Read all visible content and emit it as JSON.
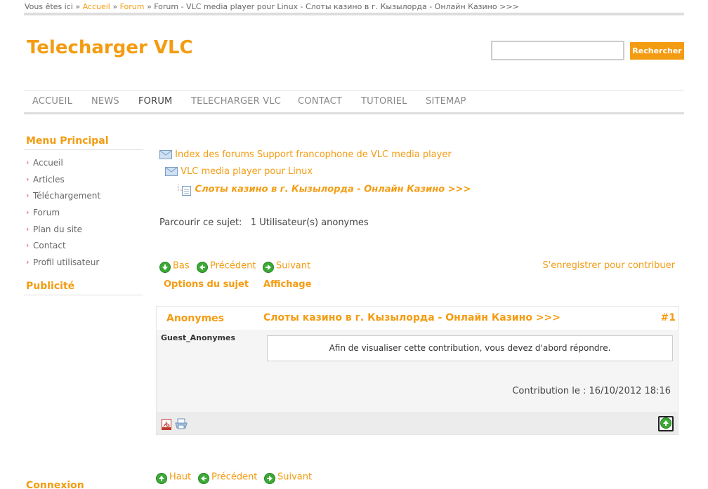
{
  "breadcrumb": {
    "prefix": "Vous êtes ici",
    "sep": "»",
    "items": [
      "Accueil",
      "Forum"
    ],
    "current": "Forum - VLC media player pour Linux - Слоты казино в г. Кызылорда - Онлайн Казино >>>"
  },
  "site": {
    "title": "Telecharger VLC"
  },
  "search": {
    "button": "Rechercher",
    "value": ""
  },
  "nav": [
    "ACCUEIL",
    "NEWS",
    "FORUM",
    "TELECHARGER VLC",
    "CONTACT",
    "TUTORIEL",
    "SITEMAP"
  ],
  "sidebar": {
    "menu_title": "Menu Principal",
    "items": [
      "Accueil",
      "Articles",
      "Téléchargement",
      "Forum",
      "Plan du site",
      "Contact",
      "Profil utilisateur"
    ],
    "pub_title": "Publicité",
    "login_title": "Connexion"
  },
  "forum": {
    "index_link": "Index des forums Support francophone de VLC media player",
    "sub_link": "VLC media player pour Linux",
    "topic": "Слоты казино в г. Кызылорда - Онлайн Казино >>>",
    "browse_label": "Parcourir ce sujet:",
    "browse_value": "1 Utilisateur(s) anonymes",
    "bas": "Bas",
    "precedent": "Précédent",
    "suivant": "Suivant",
    "register": "S'enregistrer pour contribuer",
    "options": "Options du sujet",
    "affichage": "Affichage",
    "haut": "Haut"
  },
  "post": {
    "author": "Anonymes",
    "title": "Слоты казино в г. Кызылорда - Онлайн Казино >>>",
    "number": "#1",
    "user": "Guest_Anonymes",
    "body": "Afin de visualiser cette contribution, vous devez d'abord répondre.",
    "date": "Contribution le : 16/10/2012 18:16"
  },
  "colors": {
    "accent": "#f39c12",
    "green": "#3aaa35"
  }
}
